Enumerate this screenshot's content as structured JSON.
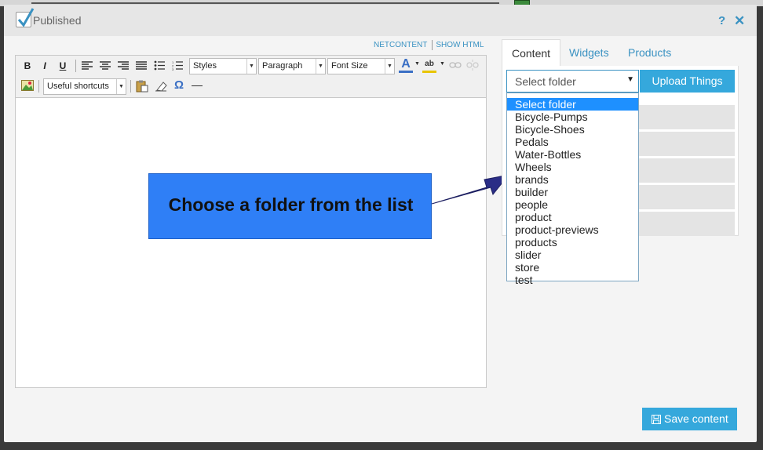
{
  "header": {
    "published_label": "Published",
    "help_glyph": "?",
    "close_glyph": "✕"
  },
  "editor_links": {
    "netcontent": "NETCONTENT",
    "show_html": "SHOW HTML"
  },
  "toolbar": {
    "bold": "B",
    "italic": "I",
    "underline": "U",
    "styles": "Styles",
    "paragraph": "Paragraph",
    "font_size": "Font Size",
    "font_color_glyph": "A",
    "highlight_glyph": "ab",
    "shortcuts": "Useful shortcuts",
    "omega": "Ω",
    "hr": "—",
    "icons": [
      "bold-icon",
      "italic-icon",
      "underline-icon",
      "align-left-icon",
      "align-center-icon",
      "align-right-icon",
      "align-justify-icon",
      "bullet-list-icon",
      "numbered-list-icon",
      "font-color-icon",
      "highlight-icon",
      "link-icon",
      "unlink-icon",
      "image-icon",
      "paste-icon",
      "eraser-icon",
      "special-char-icon",
      "horizontal-rule-icon"
    ]
  },
  "callout": {
    "text": "Choose a folder from the list"
  },
  "tabs": [
    {
      "label": "Content"
    },
    {
      "label": "Widgets"
    },
    {
      "label": "Products"
    }
  ],
  "folder_select": {
    "selected": "Select folder",
    "options": [
      "Select folder",
      "Bicycle-Pumps",
      "Bicycle-Shoes",
      "Pedals",
      "Water-Bottles",
      "Wheels",
      "brands",
      "builder",
      "people",
      "product",
      "product-previews",
      "products",
      "slider",
      "store",
      "test"
    ]
  },
  "upload_button": "Upload Things",
  "save_button": "Save content",
  "colors": {
    "accent": "#35a8dc",
    "link": "#3a92c2",
    "callout": "#2f7ff6",
    "dropdown_highlight": "#1e90ff"
  }
}
